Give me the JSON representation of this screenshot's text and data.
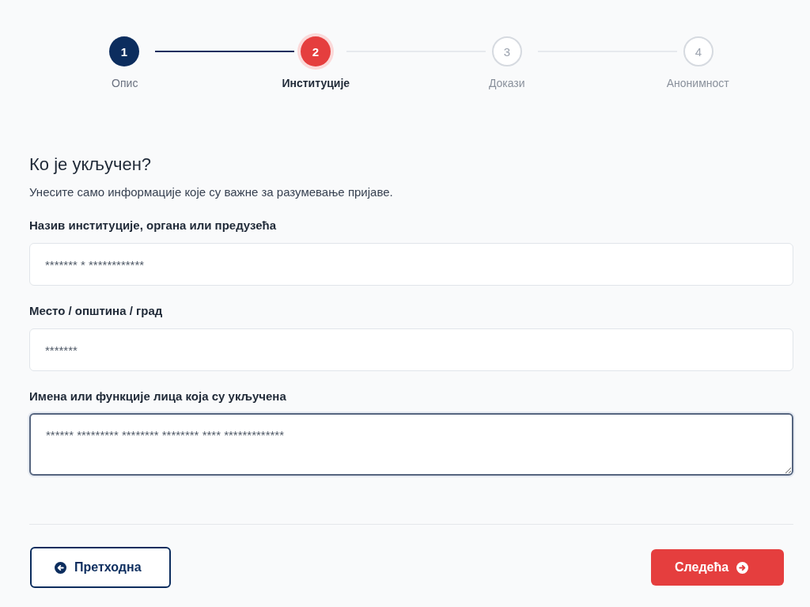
{
  "stepper": {
    "steps": [
      {
        "number": "1",
        "label": "Опис",
        "completed": true,
        "selected": false
      },
      {
        "number": "2",
        "label": "Институције",
        "completed": false,
        "selected": true
      },
      {
        "number": "3",
        "label": "Докази",
        "completed": false,
        "selected": false
      },
      {
        "number": "4",
        "label": "Анонимност",
        "completed": false,
        "selected": false
      }
    ]
  },
  "section": {
    "title": "Ко је укључен?",
    "description": "Унесите само информације које су важне за разумевање пријаве."
  },
  "fields": [
    {
      "kind": "input",
      "label": "Назив институције, органа или предузећа",
      "value": "******* * ************",
      "focused": false
    },
    {
      "kind": "input",
      "label": "Место / општина / град",
      "value": "*******",
      "focused": false
    },
    {
      "kind": "textarea",
      "label": "Имена или функције лица која су укључена",
      "value": "****** ********* ******** ******** **** *************",
      "focused": true
    }
  ],
  "buttons": [
    {
      "kind": "back",
      "label": "Претходна"
    },
    {
      "kind": "next",
      "label": "Следећа"
    }
  ]
}
